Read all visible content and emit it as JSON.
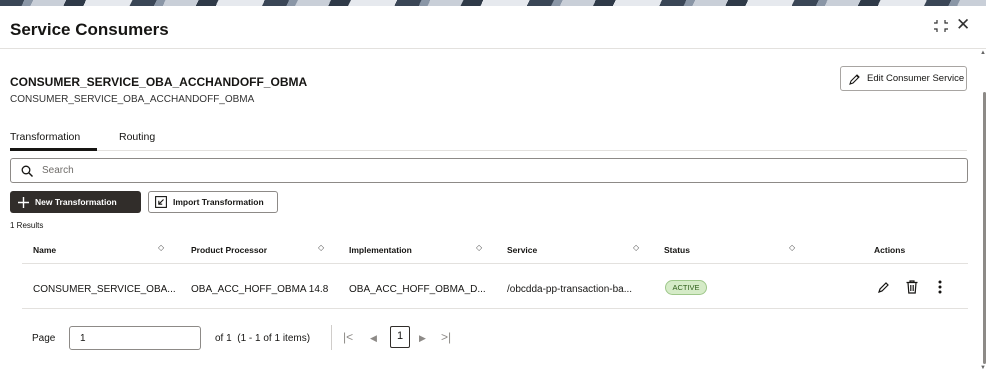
{
  "header": {
    "title": "Service Consumers"
  },
  "consumer": {
    "name": "CONSUMER_SERVICE_OBA_ACCHANDOFF_OBMA",
    "subtitle": "CONSUMER_SERVICE_OBA_ACCHANDOFF_OBMA",
    "edit_label": "Edit Consumer Service"
  },
  "tabs": [
    {
      "label": "Transformation",
      "active": true
    },
    {
      "label": "Routing",
      "active": false
    }
  ],
  "search": {
    "placeholder": "Search",
    "value": ""
  },
  "toolbar": {
    "new_label": "New Transformation",
    "import_label": "Import Transformation"
  },
  "results": {
    "text": "1 Results"
  },
  "table": {
    "columns": [
      "Name",
      "Product Processor",
      "Implementation",
      "Service",
      "Status",
      "Actions"
    ],
    "rows": [
      {
        "name": "CONSUMER_SERVICE_OBA...",
        "product_processor": "OBA_ACC_HOFF_OBMA 14.8",
        "implementation": "OBA_ACC_HOFF_OBMA_D...",
        "service": "/obcdda-pp-transaction-ba...",
        "status": "ACTIVE"
      }
    ]
  },
  "pagination": {
    "page_label": "Page",
    "page_value": "1",
    "of_text": "of 1",
    "range_text": "(1 - 1 of 1 items)",
    "current": "1"
  },
  "colors": {
    "primary_dark": "#312d2a",
    "badge_bg": "#d5ebc7",
    "badge_text": "#2f5e1a"
  },
  "icons": [
    "expand-icon",
    "close-icon",
    "pencil-icon",
    "search-icon",
    "plus-icon",
    "import-icon",
    "sort-icon",
    "edit-icon",
    "delete-icon",
    "more-icon",
    "first-page-icon",
    "prev-page-icon",
    "next-page-icon",
    "last-page-icon"
  ]
}
